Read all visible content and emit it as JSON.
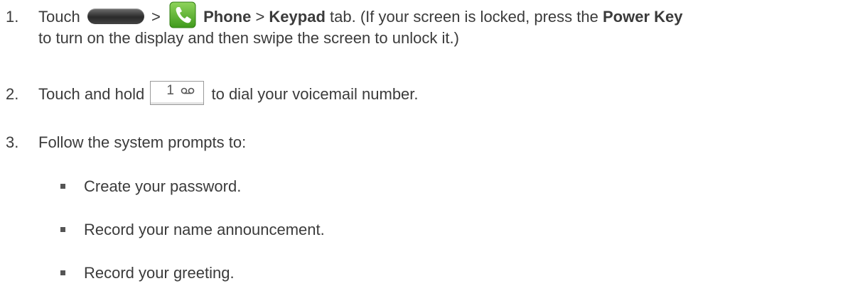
{
  "steps": [
    {
      "number": "1.",
      "parts": {
        "touch": "Touch",
        "sep1": ">",
        "phone": "Phone",
        "sep2": ">",
        "keypad": "Keypad",
        "tab_text": "tab. (If your screen is locked, press the",
        "power_key": "Power Key",
        "continuation": "to turn on the display and then swipe the screen to unlock it.)"
      }
    },
    {
      "number": "2.",
      "parts": {
        "before": "Touch and hold",
        "key_digit": "1",
        "after": "to dial your voicemail number."
      }
    },
    {
      "number": "3.",
      "parts": {
        "text": "Follow the system prompts to:"
      }
    }
  ],
  "bullets": [
    "Create your password.",
    "Record your name announcement.",
    "Record your greeting."
  ],
  "icons": {
    "home_key": "home-key-icon",
    "phone_app": "phone-app-icon",
    "voicemail_key": "voicemail-key-icon"
  },
  "colors": {
    "text": "#3b3b3b",
    "phone_icon_green": "#5cb82e"
  }
}
